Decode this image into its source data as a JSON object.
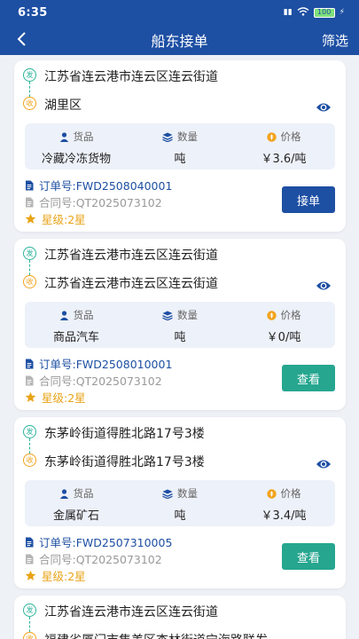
{
  "status_bar": {
    "time": "6:35",
    "battery": "100"
  },
  "nav": {
    "title": "船东接单",
    "filter_label": "筛选"
  },
  "icons": {
    "back": "chevron-left-icon",
    "view": "eye-icon",
    "goods": "person-icon",
    "quantity": "layers-icon",
    "price": "coin-icon",
    "order": "document-icon",
    "contract": "document-icon",
    "rating": "star-icon"
  },
  "colors": {
    "primary": "#1d4fa3",
    "teal": "#26a68f",
    "origin": "#2bb39a",
    "destination": "#f2a21a",
    "star": "#e8a317"
  },
  "labels": {
    "origin_badge": "发",
    "dest_badge": "收",
    "goods_head": "货品",
    "quantity_head": "数量",
    "price_head": "价格"
  },
  "orders": [
    {
      "origin": "江苏省连云港市连云区连云街道",
      "destination": "湖里区",
      "goods": "冷藏冷冻货物",
      "unit": "吨",
      "price": "￥3.6/吨",
      "order_no": "订单号:FWD2508040001",
      "contract_no": "合同号:QT2025073102",
      "rating": "星级:2星",
      "action": "接单"
    },
    {
      "origin": "江苏省连云港市连云区连云街道",
      "destination": "江苏省连云港市连云区连云街道",
      "goods": "商品汽车",
      "unit": "吨",
      "price": "￥0/吨",
      "order_no": "订单号:FWD2508010001",
      "contract_no": "合同号:QT2025073102",
      "rating": "星级:2星",
      "action": "查看"
    },
    {
      "origin": "东茅岭街道得胜北路17号3楼",
      "destination": "东茅岭街道得胜北路17号3楼",
      "goods": "金属矿石",
      "unit": "吨",
      "price": "￥3.4/吨",
      "order_no": "订单号:FWD2507310005",
      "contract_no": "合同号:QT2025073102",
      "rating": "星级:2星",
      "action": "查看"
    },
    {
      "origin": "江苏省连云港市连云区连云街道",
      "destination": "福建省厦门市集美区杏林街道宁海路联发"
    }
  ]
}
